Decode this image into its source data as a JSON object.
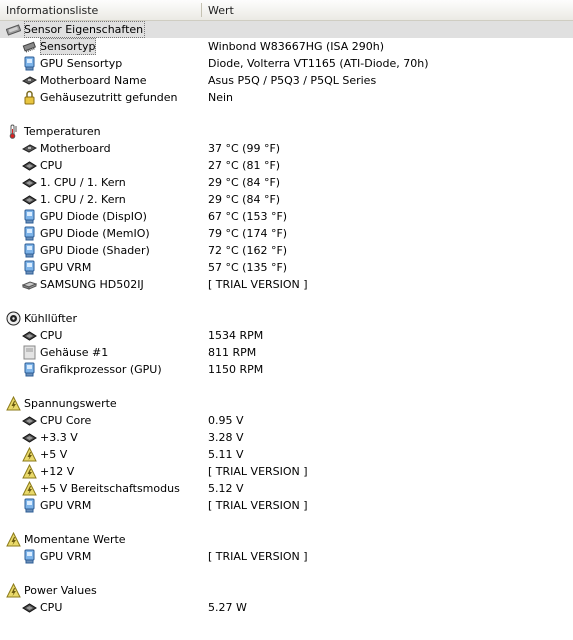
{
  "header": {
    "col_name": "Informationsliste",
    "col_value": "Wert"
  },
  "colors": {
    "selected_row": "#e0e0e0",
    "header_bg": "#ebeae4"
  },
  "rows": [
    {
      "kind": "group",
      "icon": "sensor-chip-icon",
      "name": "Sensor Eigenschaften",
      "value": "",
      "selected": true
    },
    {
      "kind": "item",
      "icon": "chip-icon",
      "name": "Sensortyp",
      "value": "Winbond W83667HG  (ISA 290h)",
      "outlined": true
    },
    {
      "kind": "item",
      "icon": "gpu-icon",
      "name": "GPU Sensortyp",
      "value": "Diode, Volterra VT1165  (ATI-Diode, 70h)"
    },
    {
      "kind": "item",
      "icon": "motherboard-icon",
      "name": "Motherboard Name",
      "value": "Asus P5Q / P5Q3 / P5QL Series"
    },
    {
      "kind": "item",
      "icon": "lock-icon",
      "name": "Gehäusezutritt gefunden",
      "value": "Nein"
    },
    {
      "kind": "spacer"
    },
    {
      "kind": "group",
      "icon": "thermometer-icon",
      "name": "Temperaturen",
      "value": ""
    },
    {
      "kind": "item",
      "icon": "motherboard-icon",
      "name": "Motherboard",
      "value": "37 °C  (99 °F)"
    },
    {
      "kind": "item",
      "icon": "cpu-icon",
      "name": "CPU",
      "value": "27 °C  (81 °F)"
    },
    {
      "kind": "item",
      "icon": "cpu-icon",
      "name": "1. CPU / 1. Kern",
      "value": "29 °C  (84 °F)"
    },
    {
      "kind": "item",
      "icon": "cpu-icon",
      "name": "1. CPU / 2. Kern",
      "value": "29 °C  (84 °F)"
    },
    {
      "kind": "item",
      "icon": "gpu-icon",
      "name": "GPU Diode (DispIO)",
      "value": "67 °C  (153 °F)"
    },
    {
      "kind": "item",
      "icon": "gpu-icon",
      "name": "GPU Diode (MemIO)",
      "value": "79 °C  (174 °F)"
    },
    {
      "kind": "item",
      "icon": "gpu-icon",
      "name": "GPU Diode (Shader)",
      "value": "72 °C  (162 °F)"
    },
    {
      "kind": "item",
      "icon": "gpu-icon",
      "name": "GPU VRM",
      "value": "57 °C  (135 °F)"
    },
    {
      "kind": "item",
      "icon": "harddisk-icon",
      "name": "SAMSUNG HD502IJ",
      "value": "[ TRIAL VERSION ]"
    },
    {
      "kind": "spacer"
    },
    {
      "kind": "group",
      "icon": "fan-icon",
      "name": "Kühllüfter",
      "value": ""
    },
    {
      "kind": "item",
      "icon": "cpu-icon",
      "name": "CPU",
      "value": "1534 RPM"
    },
    {
      "kind": "item",
      "icon": "case-icon",
      "name": "Gehäuse #1",
      "value": "811 RPM"
    },
    {
      "kind": "item",
      "icon": "gpu-icon",
      "name": "Grafikprozessor (GPU)",
      "value": "1150 RPM"
    },
    {
      "kind": "spacer"
    },
    {
      "kind": "group",
      "icon": "voltage-icon",
      "name": "Spannungswerte",
      "value": ""
    },
    {
      "kind": "item",
      "icon": "cpu-icon",
      "name": "CPU Core",
      "value": "0.95 V"
    },
    {
      "kind": "item",
      "icon": "cpu-icon",
      "name": "+3.3 V",
      "value": "3.28 V"
    },
    {
      "kind": "item",
      "icon": "voltage-icon",
      "name": "+5 V",
      "value": "5.11 V"
    },
    {
      "kind": "item",
      "icon": "voltage-icon",
      "name": "+12 V",
      "value": "[ TRIAL VERSION ]"
    },
    {
      "kind": "item",
      "icon": "voltage-icon",
      "name": "+5 V Bereitschaftsmodus",
      "value": "5.12 V"
    },
    {
      "kind": "item",
      "icon": "gpu-icon",
      "name": "GPU VRM",
      "value": "[ TRIAL VERSION ]"
    },
    {
      "kind": "spacer"
    },
    {
      "kind": "group",
      "icon": "voltage-icon",
      "name": "Momentane Werte",
      "value": ""
    },
    {
      "kind": "item",
      "icon": "gpu-icon",
      "name": "GPU VRM",
      "value": "[ TRIAL VERSION ]"
    },
    {
      "kind": "spacer"
    },
    {
      "kind": "group",
      "icon": "voltage-icon",
      "name": "Power Values",
      "value": ""
    },
    {
      "kind": "item",
      "icon": "cpu-icon",
      "name": "CPU",
      "value": "5.27 W"
    }
  ]
}
